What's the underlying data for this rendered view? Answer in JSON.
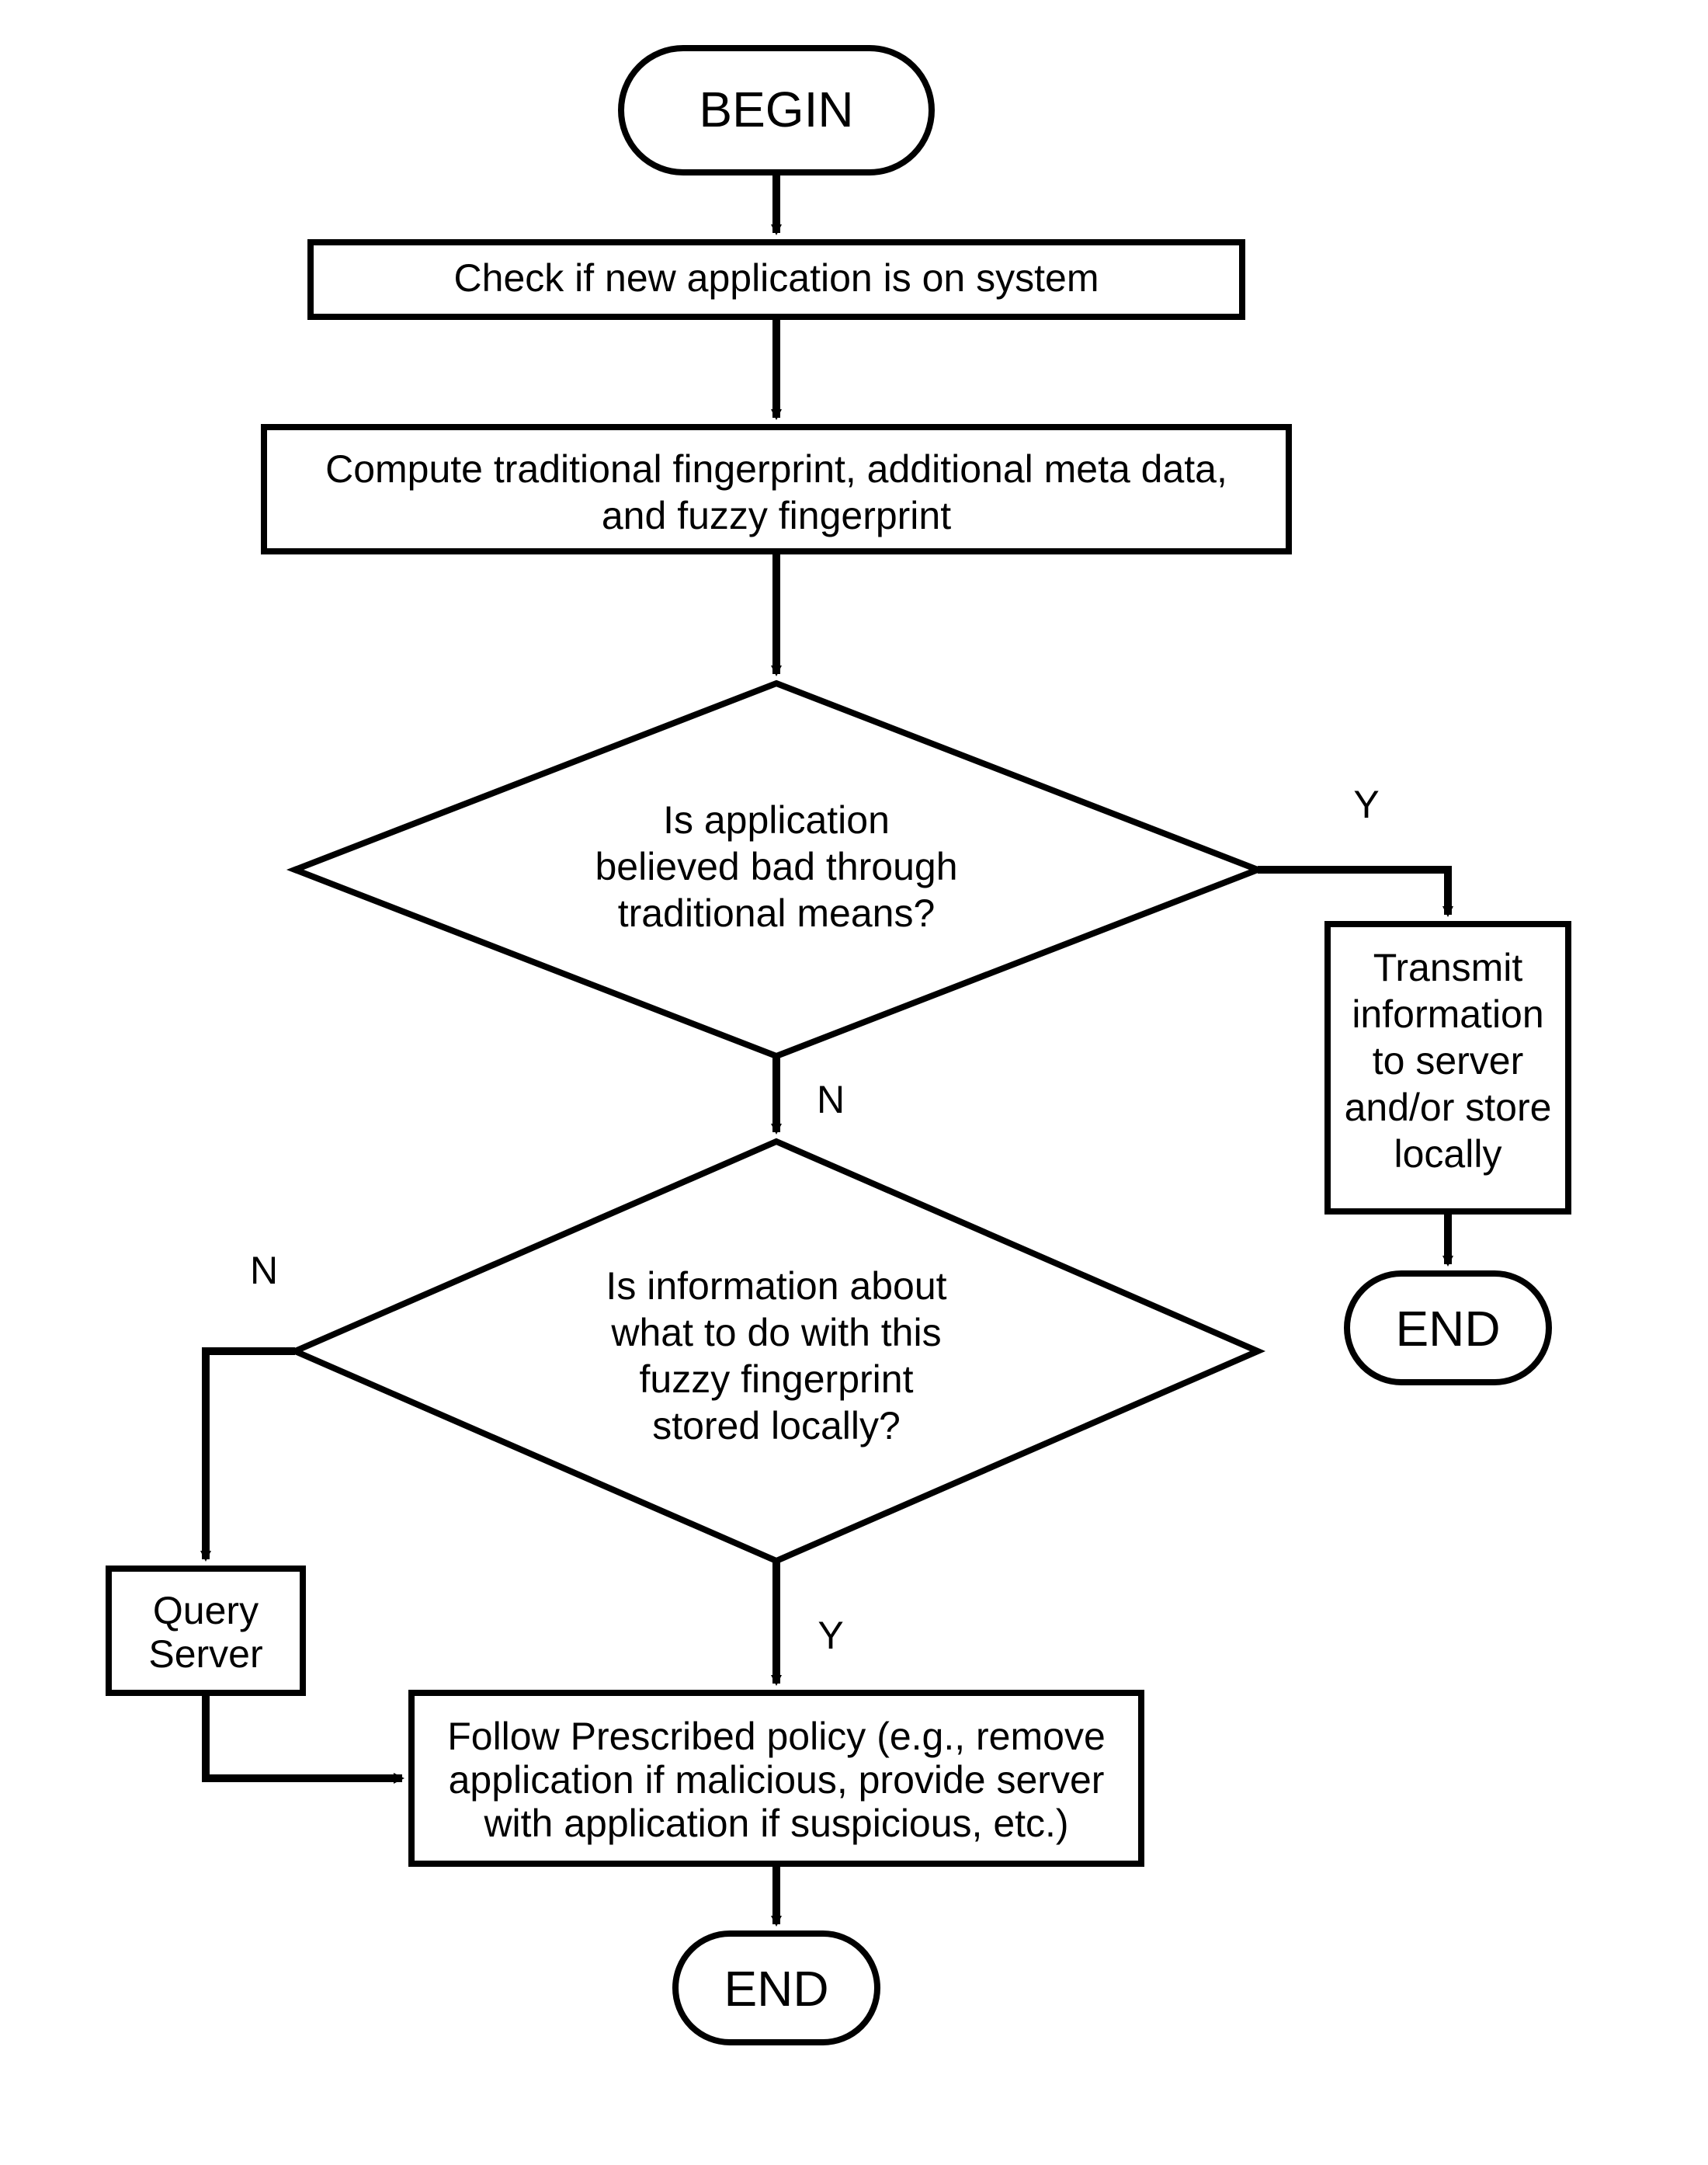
{
  "nodes": {
    "begin": "BEGIN",
    "check": "Check if new application is on system",
    "compute1": "Compute traditional fingerprint, additional meta data,",
    "compute2": "and fuzzy fingerprint",
    "d1a": "Is application",
    "d1b": "believed bad through",
    "d1c": "traditional means?",
    "d2a": "Is information about",
    "d2b": "what to do with this",
    "d2c": "fuzzy fingerprint",
    "d2d": "stored locally?",
    "trans1": "Transmit",
    "trans2": "information",
    "trans3": "to server",
    "trans4": "and/or store",
    "trans5": "locally",
    "q1": "Query",
    "q2": "Server",
    "pol1": "Follow Prescribed policy (e.g., remove",
    "pol2": "application if malicious, provide server",
    "pol3": "with application if suspicious, etc.)",
    "end1": "END",
    "end2": "END"
  },
  "edges": {
    "Y": "Y",
    "N": "N"
  }
}
